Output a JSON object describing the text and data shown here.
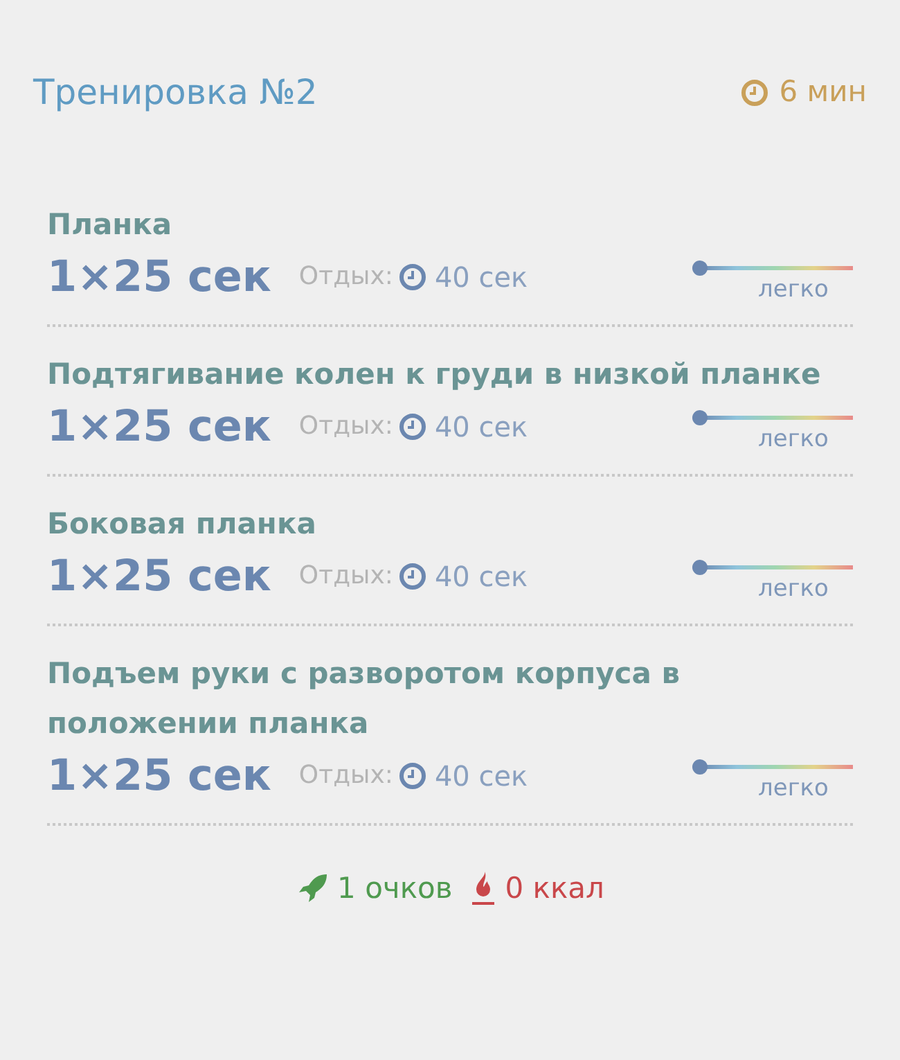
{
  "header": {
    "title": "Тренировка №2",
    "duration": "6 мин"
  },
  "exercises": [
    {
      "name": "Планка",
      "reps": "1×25 сек",
      "rest_label": "Отдых:",
      "rest": "40 сек",
      "difficulty": {
        "level": 0,
        "label": "легко"
      }
    },
    {
      "name": "Подтягивание колен к груди в низкой планке",
      "reps": "1×25 сек",
      "rest_label": "Отдых:",
      "rest": "40 сек",
      "difficulty": {
        "level": 0,
        "label": "легко"
      }
    },
    {
      "name": "Боковая планка",
      "reps": "1×25 сек",
      "rest_label": "Отдых:",
      "rest": "40 сек",
      "difficulty": {
        "level": 0,
        "label": "легко"
      }
    },
    {
      "name": "Подъем руки с разворотом корпуса в положении планка",
      "reps": "1×25 сек",
      "rest_label": "Отдых:",
      "rest": "40 сек",
      "difficulty": {
        "level": 0,
        "label": "легко"
      }
    }
  ],
  "footer": {
    "points": "1 очков",
    "calories": "0 ккал"
  }
}
